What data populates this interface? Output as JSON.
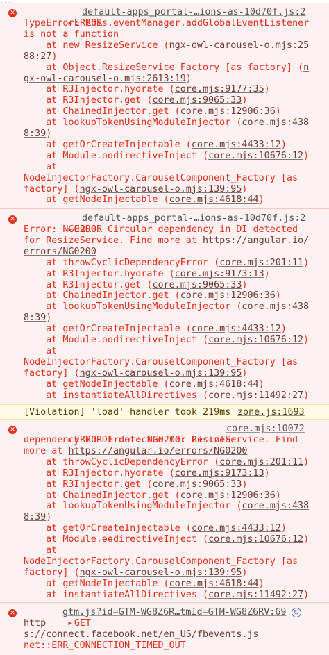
{
  "top_fade": "....",
  "messages": [
    {
      "kind": "error",
      "head": "ERROR",
      "source": "default-apps_portal-…ions-as-10d70f.js:2",
      "lines": [
        [
          "TypeError: this.eventManager.addGlobalEventListener"
        ],
        [
          "is not a function"
        ],
        [
          "    at new ResizeService (",
          {
            "link": "ngx-owl-carousel-o.mjs:25"
          }
        ],
        [
          {
            "link": "88:27"
          },
          ")"
        ],
        [
          "    at Object.ResizeService_Factory [as factory] (",
          {
            "link": "n"
          }
        ],
        [
          {
            "link": "gx-owl-carousel-o.mjs:2613:19"
          },
          ")"
        ],
        [
          "    at R3Injector.hydrate (",
          {
            "link": "core.mjs:9177:35"
          },
          ")"
        ],
        [
          "    at R3Injector.get (",
          {
            "link": "core.mjs:9065:33"
          },
          ")"
        ],
        [
          "    at ChainedInjector.get (",
          {
            "link": "core.mjs:12906:36"
          },
          ")"
        ],
        [
          "    at lookupTokenUsingModuleInjector (",
          {
            "link": "core.mjs:438"
          }
        ],
        [
          {
            "link": "8:39"
          },
          ")"
        ],
        [
          "    at getOrCreateInjectable (",
          {
            "link": "core.mjs:4433:12"
          },
          ")"
        ],
        [
          "    at Module.ɵɵdirectiveInject (",
          {
            "link": "core.mjs:10676:12"
          },
          ")"
        ],
        [
          "    at"
        ],
        [
          "NodeInjectorFactory.CarouselComponent_Factory [as"
        ],
        [
          "factory] (",
          {
            "link": "ngx-owl-carousel-o.mjs:139:95"
          },
          ")"
        ],
        [
          "    at getNodeInjectable (",
          {
            "link": "core.mjs:4618:44"
          },
          ")"
        ]
      ]
    },
    {
      "kind": "error",
      "head": "ERROR",
      "source": "default-apps_portal-…ions-as-10d70f.js:2",
      "lines": [
        [
          "Error: NG0200: Circular dependency in DI detected"
        ],
        [
          "for ResizeService. Find more at ",
          {
            "link": "https://angular.io/"
          }
        ],
        [
          {
            "link": "errors/NG0200"
          }
        ],
        [
          "    at throwCyclicDependencyError (",
          {
            "link": "core.mjs:201:11"
          },
          ")"
        ],
        [
          "    at R3Injector.hydrate (",
          {
            "link": "core.mjs:9173:13"
          },
          ")"
        ],
        [
          "    at R3Injector.get (",
          {
            "link": "core.mjs:9065:33"
          },
          ")"
        ],
        [
          "    at ChainedInjector.get (",
          {
            "link": "core.mjs:12906:36"
          },
          ")"
        ],
        [
          "    at lookupTokenUsingModuleInjector (",
          {
            "link": "core.mjs:438"
          }
        ],
        [
          {
            "link": "8:39"
          },
          ")"
        ],
        [
          "    at getOrCreateInjectable (",
          {
            "link": "core.mjs:4433:12"
          },
          ")"
        ],
        [
          "    at Module.ɵɵdirectiveInject (",
          {
            "link": "core.mjs:10676:12"
          },
          ")"
        ],
        [
          "    at"
        ],
        [
          "NodeInjectorFactory.CarouselComponent_Factory [as"
        ],
        [
          "factory] (",
          {
            "link": "ngx-owl-carousel-o.mjs:139:95"
          },
          ")"
        ],
        [
          "    at getNodeInjectable (",
          {
            "link": "core.mjs:4618:44"
          },
          ")"
        ],
        [
          "    at instantiateAllDirectives (",
          {
            "link": "core.mjs:11492:27"
          },
          ")"
        ]
      ]
    },
    {
      "kind": "violation",
      "text": "[Violation] 'load' handler took 219ms",
      "source": "zone.js:1693"
    },
    {
      "kind": "error",
      "head": "ERROR Error: NG0200: Circular",
      "source": "core.mjs:10072",
      "lines": [
        [
          "dependency in DI detected for ResizeService. Find"
        ],
        [
          "more at ",
          {
            "link": "https://angular.io/errors/NG0200"
          }
        ],
        [
          "    at throwCyclicDependencyError (",
          {
            "link": "core.mjs:201:11"
          },
          ")"
        ],
        [
          "    at R3Injector.hydrate (",
          {
            "link": "core.mjs:9173:13"
          },
          ")"
        ],
        [
          "    at R3Injector.get (",
          {
            "link": "core.mjs:9065:33"
          },
          ")"
        ],
        [
          "    at ChainedInjector.get (",
          {
            "link": "core.mjs:12906:36"
          },
          ")"
        ],
        [
          "    at lookupTokenUsingModuleInjector (",
          {
            "link": "core.mjs:438"
          }
        ],
        [
          {
            "link": "8:39"
          },
          ")"
        ],
        [
          "    at getOrCreateInjectable (",
          {
            "link": "core.mjs:4433:12"
          },
          ")"
        ],
        [
          "    at Module.ɵɵdirectiveInject (",
          {
            "link": "core.mjs:10676:12"
          },
          ")"
        ],
        [
          "    at"
        ],
        [
          "NodeInjectorFactory.CarouselComponent_Factory [as"
        ],
        [
          "factory] (",
          {
            "link": "ngx-owl-carousel-o.mjs:139:95"
          },
          ")"
        ],
        [
          "    at getNodeInjectable (",
          {
            "link": "core.mjs:4618:44"
          },
          ")"
        ],
        [
          "    at instantiateAllDirectives (",
          {
            "link": "core.mjs:11492:27"
          },
          ")"
        ]
      ]
    },
    {
      "kind": "network",
      "head": "GET",
      "source": "gtm.js?id=GTM-WG8Z6R…tmId=GTM-WG8Z6RV:69",
      "lines": [
        [
          {
            "link": "http"
          }
        ],
        [
          {
            "link": "s://connect.facebook.net/en_US/fbevents.js"
          }
        ],
        [
          "net::ERR_CONNECTION_TIMED_OUT"
        ]
      ]
    }
  ],
  "colors": {
    "error_text": "#e0301e",
    "error_bg": "#fdf2f1",
    "violation_bg": "#fffbe6",
    "violation_text": "#5c3c00",
    "link": "#6d3b33"
  },
  "icons": {
    "error": "error-circle-icon",
    "expand": "expand-triangle-icon",
    "retry": "retry-icon"
  }
}
